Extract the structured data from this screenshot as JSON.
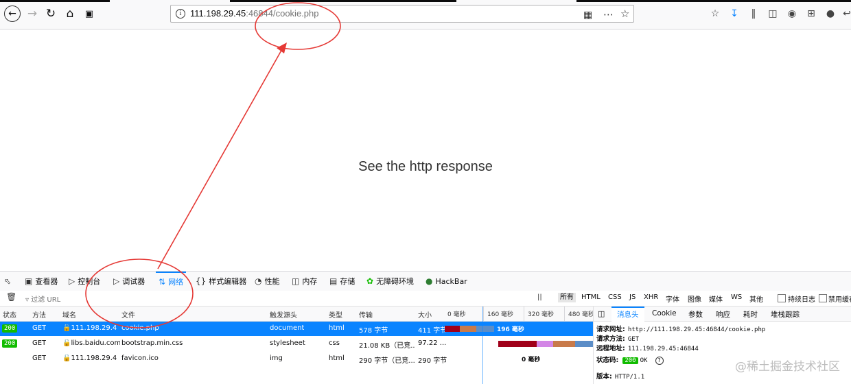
{
  "browser": {
    "url_host": "111.198.29.45",
    "url_rest": ":46844/cookie.php",
    "back_icon": "arrow-left-icon",
    "forward_icon": "arrow-right-icon",
    "reload_icon": "reload-icon",
    "home_icon": "home-icon"
  },
  "page": {
    "message": "See the http response"
  },
  "devtools": {
    "tabs": [
      {
        "label": "查看器",
        "icon": "inspector-icon"
      },
      {
        "label": "控制台",
        "icon": "console-icon"
      },
      {
        "label": "调试器",
        "icon": "debugger-icon"
      },
      {
        "label": "网络",
        "icon": "network-icon"
      },
      {
        "label": "样式编辑器",
        "icon": "style-editor-icon"
      },
      {
        "label": "性能",
        "icon": "performance-icon"
      },
      {
        "label": "内存",
        "icon": "memory-icon"
      },
      {
        "label": "存储",
        "icon": "storage-icon"
      },
      {
        "label": "无障碍环境",
        "icon": "accessibility-icon"
      },
      {
        "label": "HackBar",
        "icon": "hackbar-icon"
      }
    ],
    "filter_placeholder": "过滤 URL",
    "pause_label": "||",
    "type_filters": [
      "所有",
      "HTML",
      "CSS",
      "JS",
      "XHR",
      "字体",
      "图像",
      "媒体",
      "WS",
      "其他"
    ],
    "persist_log": "持续日志",
    "disable_cache": "禁用缓存",
    "columns": [
      "状态",
      "方法",
      "域名",
      "文件",
      "触发源头",
      "类型",
      "传输",
      "大小",
      "0 毫秒",
      "160 毫秒",
      "320 毫秒",
      "480 毫秒"
    ],
    "requests": [
      {
        "status": "200",
        "method": "GET",
        "domain": "111.198.29.4...",
        "file": "cookie.php",
        "cause": "document",
        "type": "html",
        "transferred": "578 字节",
        "size": "411 字节",
        "timing": "196 毫秒"
      },
      {
        "status": "200",
        "method": "GET",
        "domain": "libs.baidu.com",
        "file": "bootstrap.min.css",
        "cause": "stylesheet",
        "type": "css",
        "transferred": "21.08 KB（已竞...",
        "size": "97.22 ...",
        "timing": ""
      },
      {
        "status": "",
        "method": "GET",
        "domain": "111.198.29.4...",
        "file": "favicon.ico",
        "cause": "img",
        "type": "html",
        "transferred": "290 字节（已竞...",
        "size": "290 字节",
        "timing": "0 毫秒"
      }
    ],
    "side_tabs": [
      "消息头",
      "Cookie",
      "参数",
      "响应",
      "耗时",
      "堆栈跟踪"
    ],
    "headers": {
      "request_url_label": "请求网址:",
      "request_url": "http://111.198.29.45:46844/cookie.php",
      "request_method_label": "请求方法:",
      "request_method": "GET",
      "remote_addr_label": "远程地址:",
      "remote_addr": "111.198.29.45:46844",
      "status_label": "状态码:",
      "status_code": "200",
      "status_text": "OK",
      "version_label": "版本:",
      "version": "HTTP/1.1"
    }
  },
  "watermark": "@稀土掘金技术社区",
  "colors": {
    "selected_row": "#0a84ff",
    "status_ok": "#12bc00",
    "annotation": "#e53935"
  }
}
